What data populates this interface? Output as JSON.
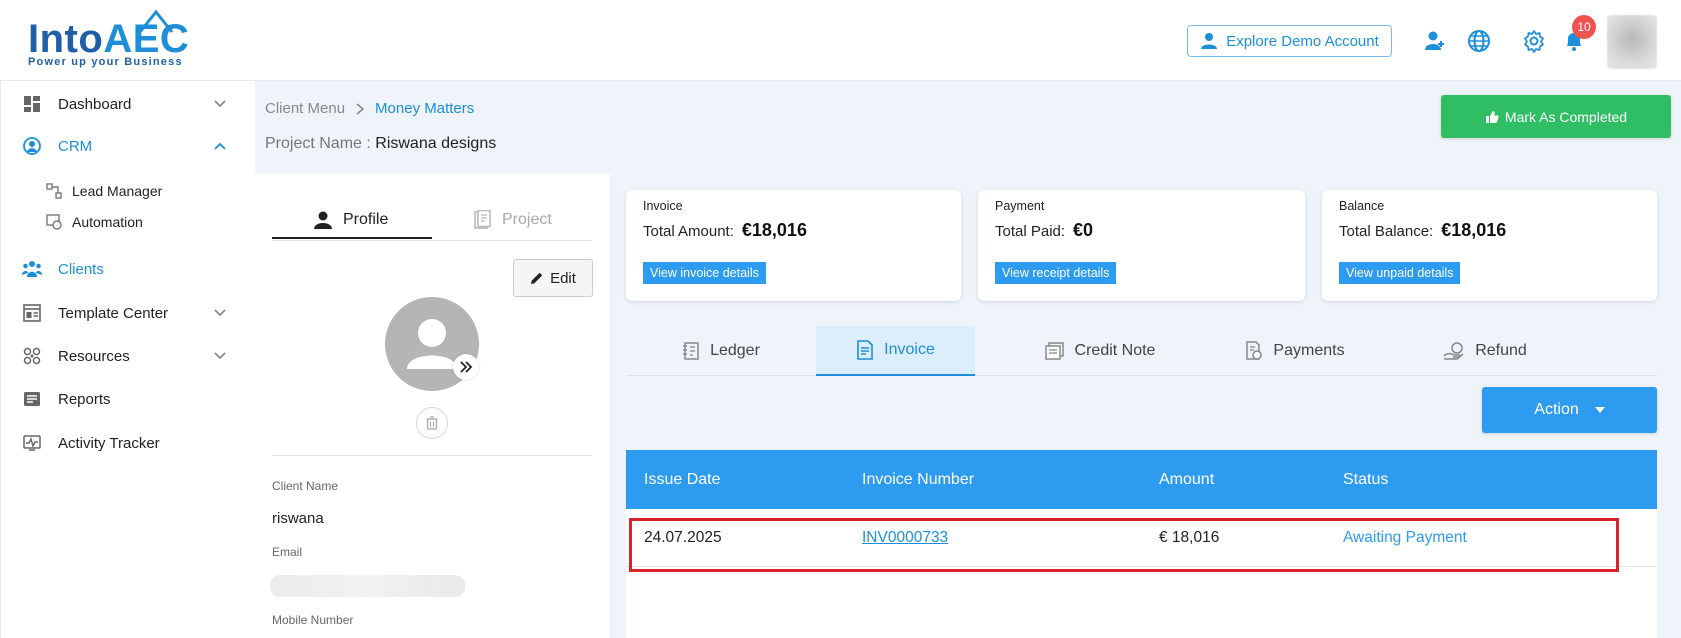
{
  "header": {
    "logo_main_a": "Into",
    "logo_main_b": "AEC",
    "logo_tagline": "Power up your Business",
    "demo_button": "Explore Demo Account",
    "notification_count": "10"
  },
  "sidebar": {
    "items": [
      {
        "label": "Dashboard",
        "icon": "dashboard-icon"
      },
      {
        "label": "CRM",
        "icon": "crm-icon"
      },
      {
        "label": "Lead Manager",
        "icon": "lead-manager-icon"
      },
      {
        "label": "Automation",
        "icon": "automation-icon"
      },
      {
        "label": "Clients",
        "icon": "clients-icon"
      },
      {
        "label": "Template Center",
        "icon": "template-icon"
      },
      {
        "label": "Resources",
        "icon": "resources-icon"
      },
      {
        "label": "Reports",
        "icon": "reports-icon"
      },
      {
        "label": "Activity Tracker",
        "icon": "activity-tracker-icon"
      }
    ]
  },
  "breadcrumb": {
    "parent": "Client Menu",
    "current": "Money Matters"
  },
  "project": {
    "label": "Project Name :",
    "value": "Riswana designs"
  },
  "mark_completed": "Mark As Completed",
  "profile": {
    "tab_profile": "Profile",
    "tab_project": "Project",
    "edit": "Edit",
    "client_name_label": "Client Name",
    "client_name": "riswana",
    "email_label": "Email",
    "mobile_label": "Mobile Number"
  },
  "cards": [
    {
      "title": "Invoice",
      "label": "Total Amount:",
      "amount": "€18,016",
      "link": "View invoice details"
    },
    {
      "title": "Payment",
      "label": "Total Paid:",
      "amount": "€0",
      "link": "View receipt details"
    },
    {
      "title": "Balance",
      "label": "Total Balance:",
      "amount": "€18,016",
      "link": "View unpaid details"
    }
  ],
  "tabs": [
    {
      "label": "Ledger",
      "active": false
    },
    {
      "label": "Invoice",
      "active": true
    },
    {
      "label": "Credit Note",
      "active": false
    },
    {
      "label": "Payments",
      "active": false
    },
    {
      "label": "Refund",
      "active": false
    }
  ],
  "action_button": "Action",
  "table": {
    "columns": [
      "Issue Date",
      "Invoice Number",
      "Amount",
      "Status"
    ],
    "rows": [
      {
        "issue_date": "24.07.2025",
        "invoice_number": "INV0000733",
        "amount": "€ 18,016",
        "status": "Awaiting Payment"
      }
    ]
  },
  "colors": {
    "accent": "#2d9bef",
    "success": "#2fbe64",
    "highlight": "#d9232b",
    "badge": "#f0544f"
  }
}
